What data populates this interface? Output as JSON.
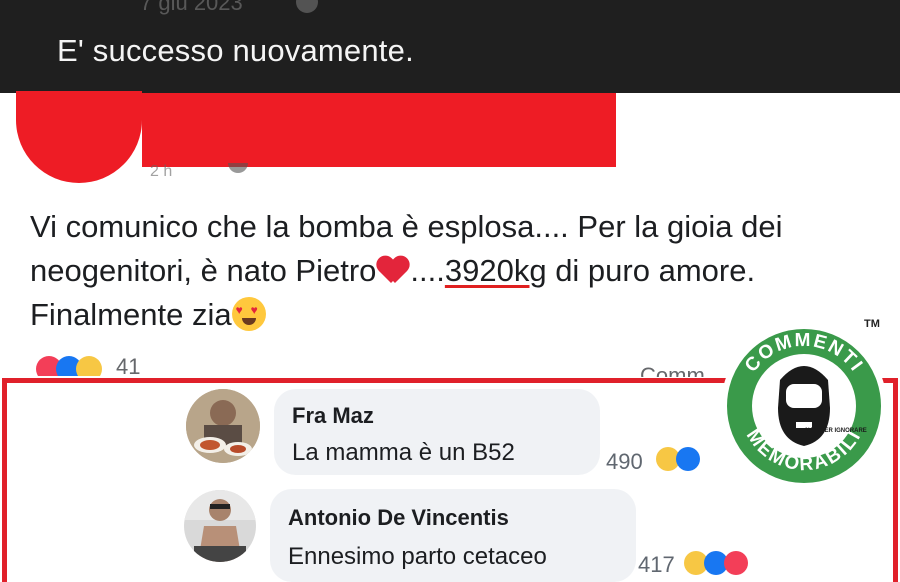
{
  "post_caption": "E' successo nuovamente.",
  "post": {
    "text_part1": "Vi comunico che la bomba è esplosa.... Per la gioia dei neogenitori, è nato Pietro",
    "text_part2": "....",
    "weight_text": "3920kg",
    "text_part3": " di puro amore. Finalmente zia",
    "reaction_count_cut": "41",
    "comments_label_cut": "Comm"
  },
  "comments": [
    {
      "author": "Fra Maz",
      "text": "La mamma è un B52",
      "reaction_count": "490",
      "reactions": [
        "haha-icon",
        "like-icon"
      ]
    },
    {
      "author": "Antonio De Vincentis",
      "text": "Ennesimo parto cetaceo",
      "reaction_count": "417",
      "reactions": [
        "haha-icon",
        "like-icon",
        "love-icon"
      ]
    }
  ],
  "logo": {
    "top_text": "COMMENTI",
    "bottom_text": "MEMORABILI",
    "inner_text": "NATI PER IGNORARE",
    "tm": "TM"
  },
  "colors": {
    "redaction": "#ee1c25",
    "frame": "#e0202a",
    "logo_green": "#3a9a4a",
    "top_bar": "#1f1f1f"
  }
}
